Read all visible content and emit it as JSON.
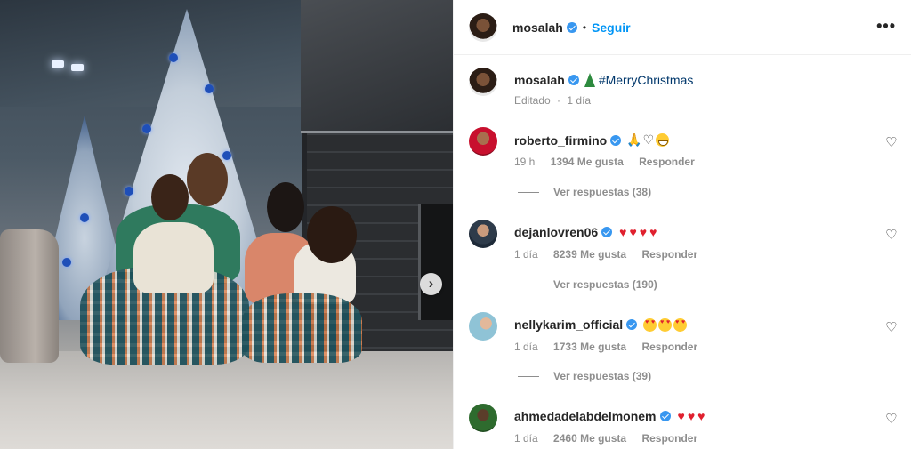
{
  "post": {
    "author": "mosalah",
    "follow_label": "Seguir",
    "more_label": "•••",
    "caption_hashtag": "#MerryChristmas",
    "caption_meta": "Editado",
    "caption_age": "1 día",
    "carousel_next": "›"
  },
  "comments": [
    {
      "username": "roberto_firmino",
      "age": "19 h",
      "likes": "1394 Me gusta",
      "reply_label": "Responder",
      "view_replies": "Ver respuestas (38)"
    },
    {
      "username": "dejanlovren06",
      "age": "1 día",
      "likes": "8239 Me gusta",
      "reply_label": "Responder",
      "view_replies": "Ver respuestas (190)"
    },
    {
      "username": "nellykarim_official",
      "age": "1 día",
      "likes": "1733 Me gusta",
      "reply_label": "Responder",
      "view_replies": "Ver respuestas (39)"
    },
    {
      "username": "ahmedadelabdelmonem",
      "age": "1 día",
      "likes": "2460 Me gusta",
      "reply_label": "Responder"
    }
  ],
  "colors": {
    "accent": "#0095f6",
    "verified": "#3897f0",
    "muted": "#8e8e8e"
  },
  "icons": [
    "verified-badge-icon",
    "more-options-icon",
    "like-heart-icon",
    "carousel-next-icon",
    "christmas-tree-emoji"
  ]
}
